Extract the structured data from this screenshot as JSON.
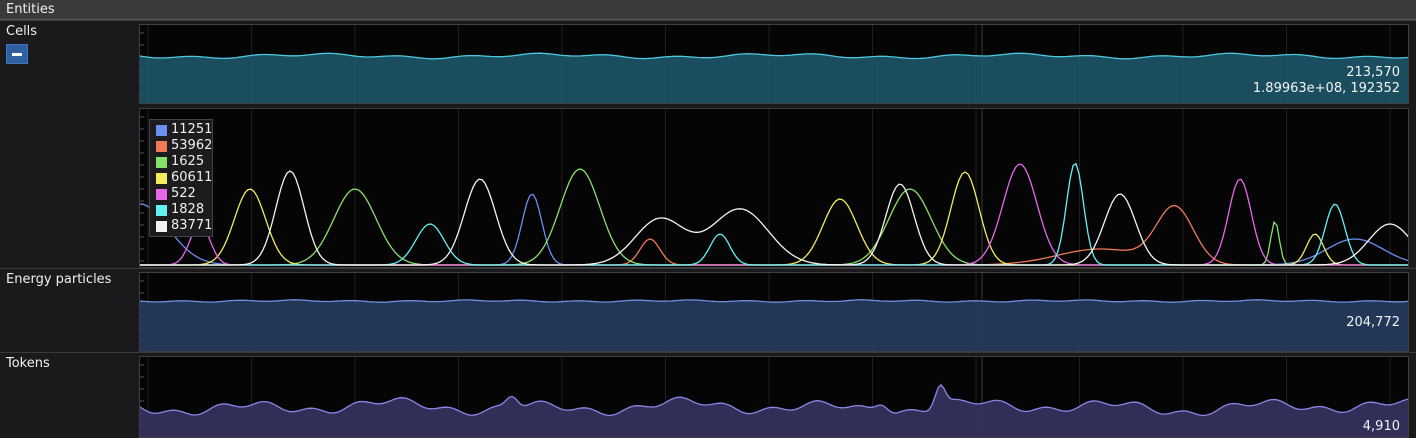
{
  "window": {
    "title": "Entities"
  },
  "rows": {
    "cells": {
      "label": "Cells",
      "value_line1": "213,570",
      "value_line2": "1.89963e+08, 192352"
    },
    "energy": {
      "label": "Energy particles",
      "value": "204,772"
    },
    "tokens": {
      "label": "Tokens",
      "value": "4,910"
    }
  },
  "legend": [
    {
      "label": "11251",
      "color": "#6d8ff0"
    },
    {
      "label": "53962",
      "color": "#f07a55"
    },
    {
      "label": "1625",
      "color": "#86e06a"
    },
    {
      "label": "60611",
      "color": "#f2ec5c"
    },
    {
      "label": "522",
      "color": "#e866e8"
    },
    {
      "label": "1828",
      "color": "#62f0f0"
    },
    {
      "label": "83771",
      "color": "#f4f4f4"
    }
  ],
  "colors": {
    "cells_fill": "#1e5a6e",
    "cells_line": "#4cc8e0",
    "energy_fill": "#2a3f66",
    "energy_line": "#6e90e0",
    "tokens_fill": "#3a3766",
    "tokens_line": "#8a86e6"
  },
  "icons": {
    "collapse": "minus-icon"
  }
}
